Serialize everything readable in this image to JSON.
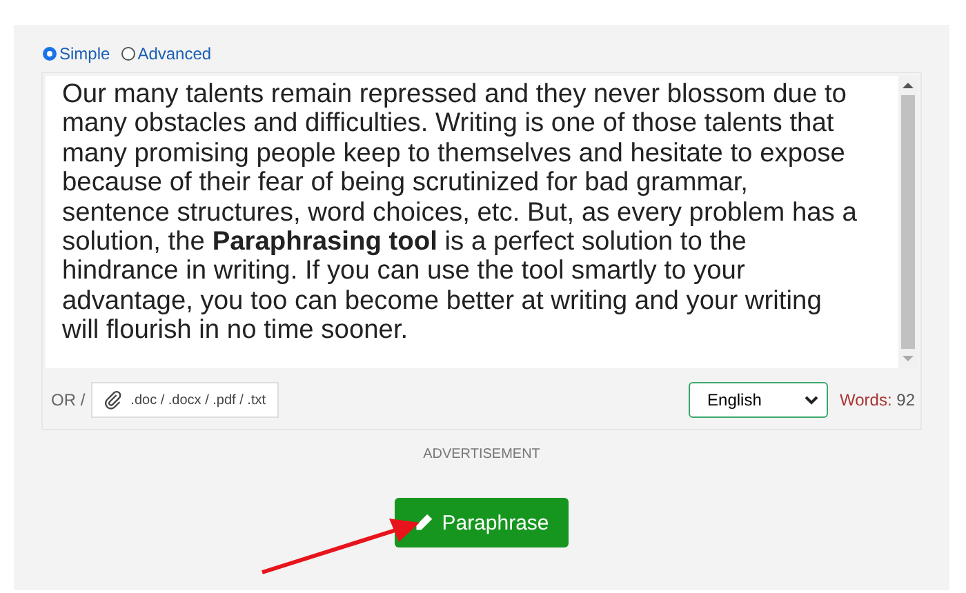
{
  "modes": [
    {
      "label": "Simple",
      "selected": true
    },
    {
      "label": "Advanced",
      "selected": false
    }
  ],
  "text": "Our many talents remain repressed and they never blossom due to many obstacles and difficulties. Writing is one of those talents that many promising people keep to themselves and hesitate to expose because of their fear of being scrutinized for bad grammar, sentence structures, word choices, etc. But, as every problem has a solution, the **Paraphrasing tool** is a perfect solution to the hindrance in writing. If you can use the tool smartly to your advantage, you too can become better at writing and your writing will flourish in no time sooner.",
  "upload": {
    "prefix": "OR /",
    "placeholder": ".doc / .docx / .pdf / .txt"
  },
  "language": "English",
  "word_count": {
    "label": "Words:",
    "value": "92"
  },
  "advertisement": "ADVERTISEMENT",
  "button": "Paraphrase"
}
